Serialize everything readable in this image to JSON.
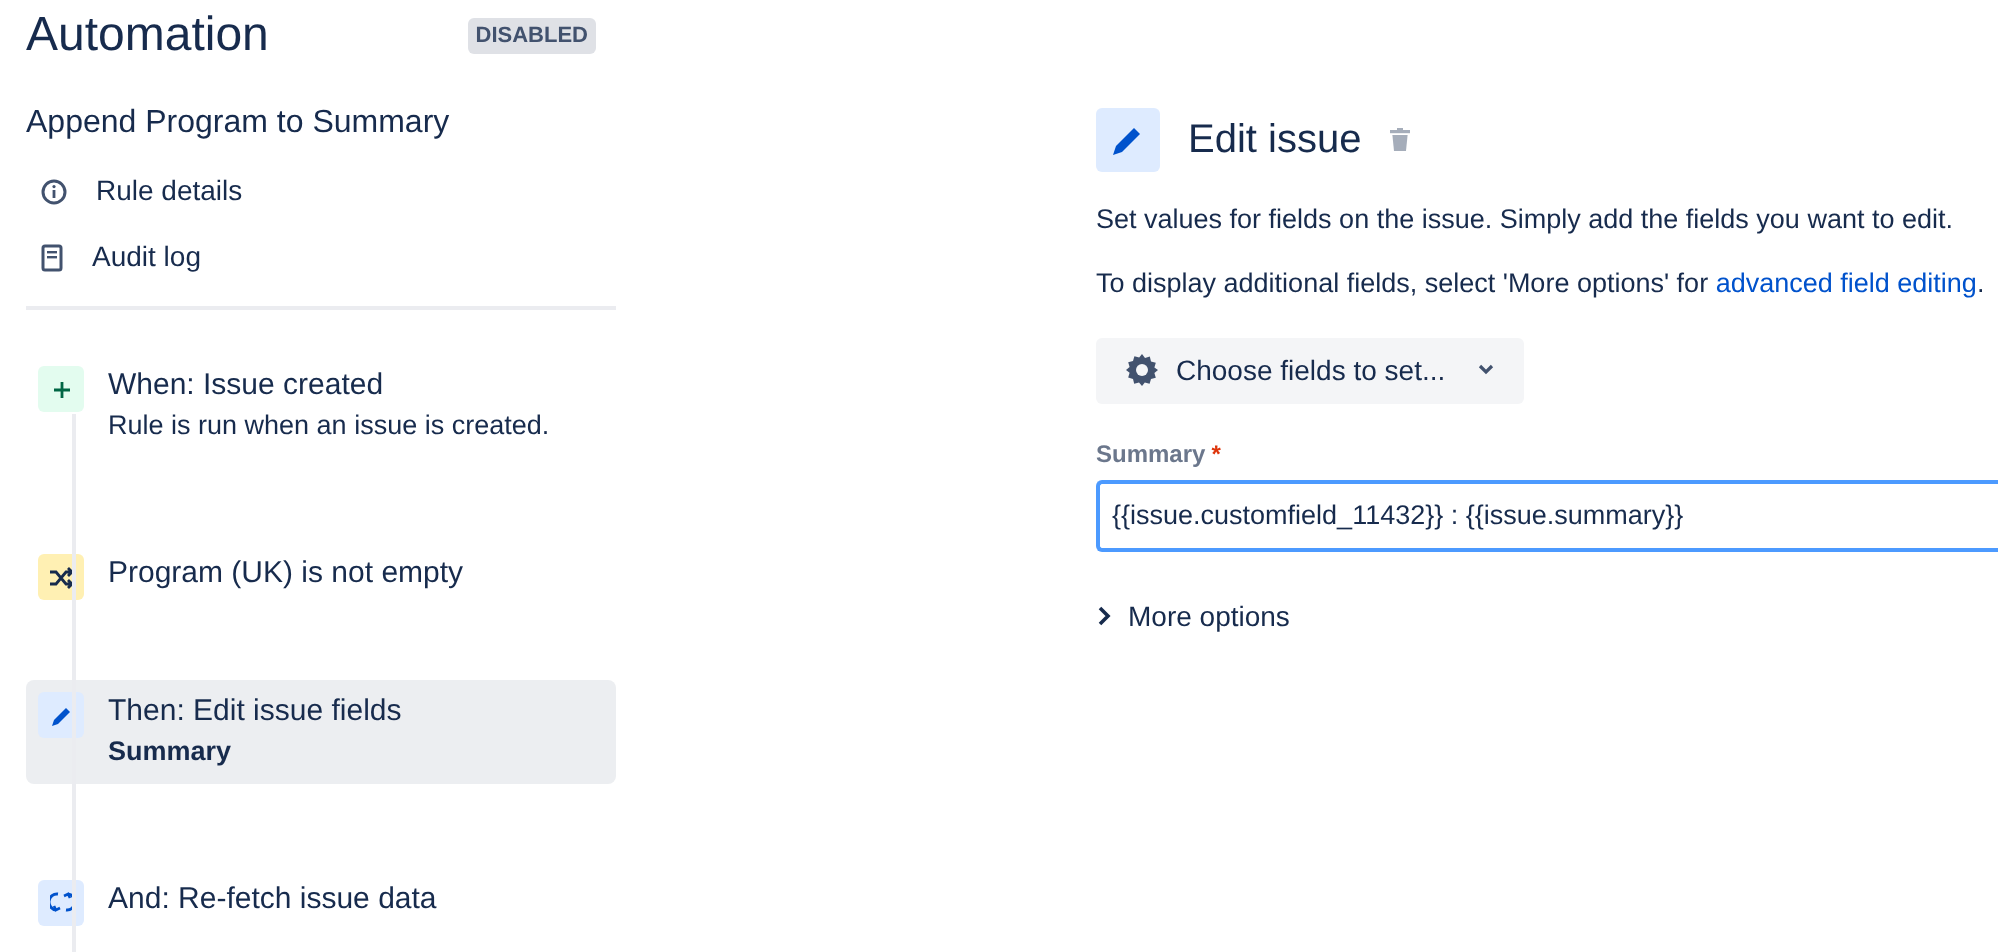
{
  "header": {
    "title": "Automation",
    "status_badge": "DISABLED"
  },
  "rule": {
    "name": "Append Program to Summary",
    "nav": [
      {
        "kind": "info",
        "label": "Rule details"
      },
      {
        "kind": "log",
        "label": "Audit log"
      }
    ]
  },
  "steps": [
    {
      "kind": "trigger",
      "title": "When: Issue created",
      "subtitle": "Rule is run when an issue is created.",
      "selected": false
    },
    {
      "kind": "condition",
      "title": "Program (UK) is not empty",
      "selected": false
    },
    {
      "kind": "action",
      "title": "Then: Edit issue fields",
      "subtitle": "Summary",
      "selected": true
    },
    {
      "kind": "refetch",
      "title": "And: Re-fetch issue data",
      "selected": false
    }
  ],
  "panel": {
    "title": "Edit issue",
    "description": "Set values for fields on the issue. Simply add the fields you want to edit.",
    "hint": {
      "text": "To display additional fields, select 'More options' for ",
      "link": "advanced field editing",
      "end": "."
    },
    "choose_button": "Choose fields to set...",
    "field": {
      "label": "Summary",
      "required_mark": "*",
      "value": "{{issue.customfield_11432}} : {{issue.summary}}",
      "focused": true
    },
    "more_options": {
      "label": "More options",
      "expanded": false
    }
  }
}
